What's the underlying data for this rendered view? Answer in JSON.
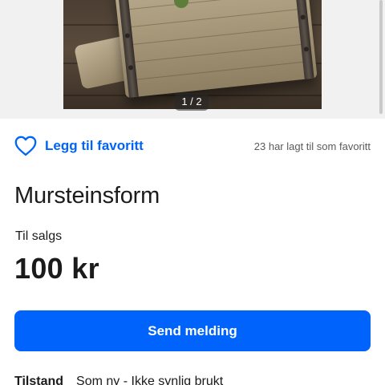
{
  "gallery": {
    "pager_text": "1 / 2",
    "photo_alt": "wooden-brick-mold-photo"
  },
  "favorite": {
    "icon": "heart-outline-icon",
    "label": "Legg til favoritt",
    "count_text": "23 har lagt til som favoritt"
  },
  "listing": {
    "title": "Mursteinsform",
    "status": "Til salgs",
    "price": "100 kr"
  },
  "actions": {
    "send_label": "Send melding"
  },
  "details": {
    "condition_label": "Tilstand",
    "condition_value": "Som ny - Ikke synlig brukt"
  },
  "colors": {
    "accent": "#0063fb",
    "text": "#1b1b1b",
    "muted": "#5a5a5a"
  }
}
